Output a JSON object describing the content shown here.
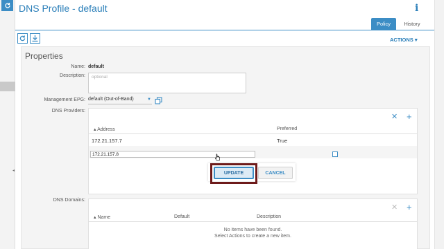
{
  "window": {
    "title": "DNS Profile - default",
    "info_glyph": "i"
  },
  "tabs": [
    {
      "label": "Policy",
      "active": true
    },
    {
      "label": "History",
      "active": false
    }
  ],
  "toolbar": {
    "refresh_icon": "refresh-icon",
    "download_icon": "download-icon",
    "actions_label": "ACTIONS ▾"
  },
  "properties": {
    "section_title": "Properties",
    "name_label": "Name:",
    "name_value": "default",
    "description_label": "Description:",
    "description_placeholder": "optional",
    "epg_label": "Management EPG:",
    "epg_value": "default (Out-of-Band)",
    "dns_providers_label": "DNS Providers:",
    "dns_domains_label": "DNS Domains:"
  },
  "dns_providers": {
    "columns": [
      "▴ Address",
      "Preferred"
    ],
    "rows": [
      {
        "address": "172.21.157.7",
        "preferred": "True"
      }
    ],
    "edit_row": {
      "address_value": "172.21.157.8",
      "preferred_checked": false
    },
    "update_label": "UPDATE",
    "cancel_label": "CANCEL",
    "close_glyph": "✕",
    "add_glyph": "+"
  },
  "dns_domains": {
    "columns": [
      "▴ Name",
      "Default",
      "Description"
    ],
    "empty_line1": "No items have been found.",
    "empty_line2": "Select Actions to create a new item.",
    "close_glyph": "✕",
    "add_glyph": "+"
  },
  "colors": {
    "accent": "#3c8dc5",
    "highlight_border": "#6d1a1a"
  }
}
